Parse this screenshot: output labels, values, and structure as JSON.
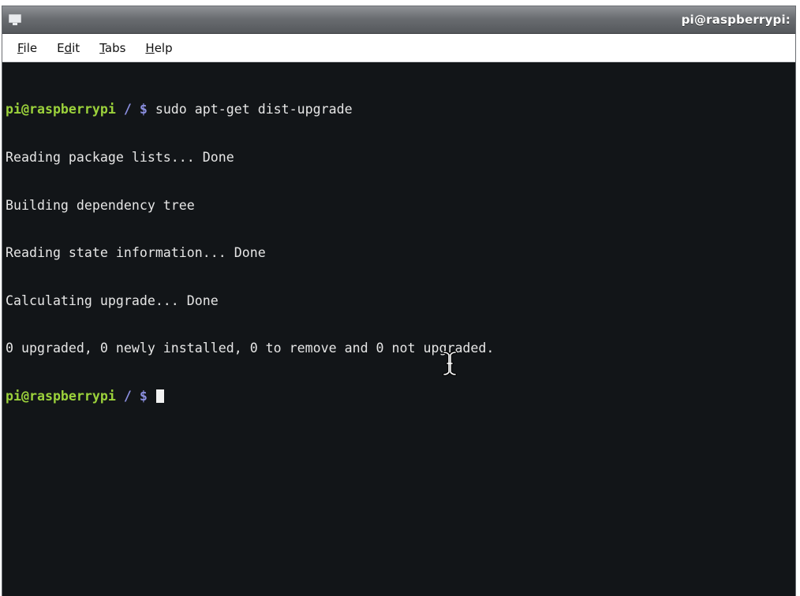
{
  "window": {
    "title": "pi@raspberrypi:",
    "icon": "terminal-icon"
  },
  "menubar": {
    "file": {
      "mnemonic": "F",
      "rest": "ile"
    },
    "edit": {
      "pre": "E",
      "mnemonic": "d",
      "rest": "it"
    },
    "tabs": {
      "mnemonic": "T",
      "rest": "abs"
    },
    "help": {
      "mnemonic": "H",
      "rest": "elp"
    }
  },
  "terminal": {
    "prompt_user": "pi@raspberrypi",
    "prompt_path": " / $ ",
    "command": "sudo apt-get dist-upgrade",
    "output": [
      "Reading package lists... Done",
      "Building dependency tree",
      "Reading state information... Done",
      "Calculating upgrade... Done",
      "0 upgraded, 0 newly installed, 0 to remove and 0 not upgraded."
    ],
    "second_prompt_path": " / $ "
  },
  "colors": {
    "background": "#121518",
    "prompt_user": "#9bd13b",
    "prompt_path": "#8b8fe0",
    "text": "#e6e6e6"
  },
  "pointer": "i-beam-cursor-icon"
}
